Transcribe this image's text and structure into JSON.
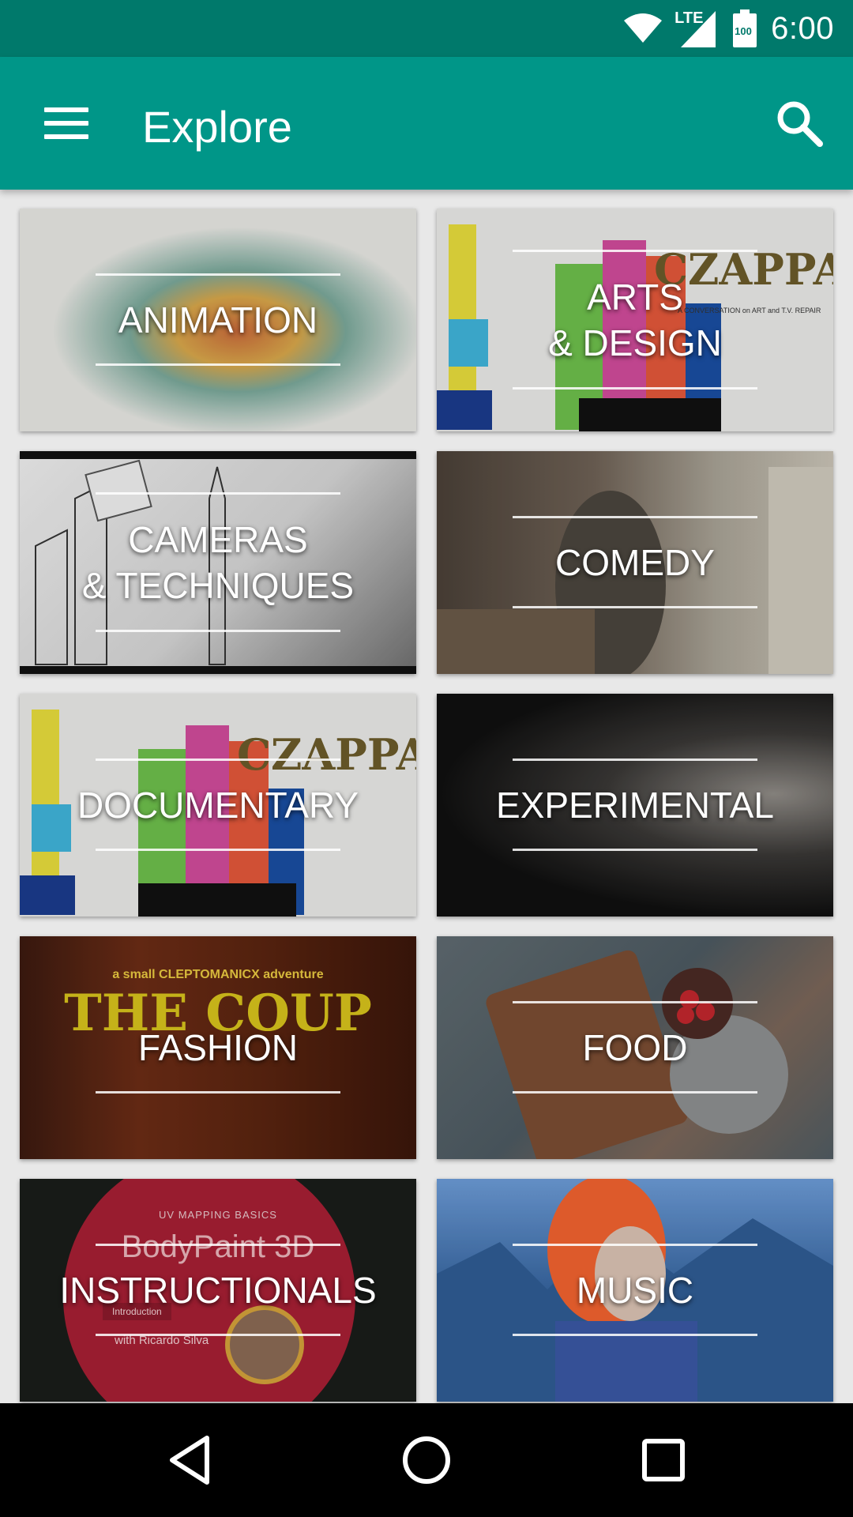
{
  "status_bar": {
    "network": "LTE",
    "battery": "100",
    "time": "6:00",
    "icons": [
      "wifi-icon",
      "signal-icon",
      "battery-icon"
    ]
  },
  "app_bar": {
    "title": "Explore",
    "menu_icon": "hamburger-menu-icon",
    "search_icon": "search-icon",
    "color": "#009688",
    "status_color": "#00796b"
  },
  "categories": [
    {
      "id": "animation",
      "label": "ANIMATION"
    },
    {
      "id": "arts-design",
      "label": "ARTS\n& DESIGN"
    },
    {
      "id": "cameras-techniques",
      "label": "CAMERAS\n& TECHNIQUES"
    },
    {
      "id": "comedy",
      "label": "COMEDY"
    },
    {
      "id": "documentary",
      "label": "DOCUMENTARY"
    },
    {
      "id": "experimental",
      "label": "EXPERIMENTAL"
    },
    {
      "id": "fashion",
      "label": "FASHION"
    },
    {
      "id": "food",
      "label": "FOOD"
    },
    {
      "id": "instructionals",
      "label": "INSTRUCTIONALS"
    },
    {
      "id": "music",
      "label": "MUSIC"
    }
  ],
  "thumbnail_text": {
    "czappa": "CZAPPA",
    "czappa_sub": "A CONVERSATION on ART and T.V. REPAIR",
    "coup_tagline": "a small CLEPTOMANICX adventure",
    "coup_title": "THE COUP",
    "uv_title": "UV MAPPING BASICS",
    "bodypaint": "BodyPaint 3D",
    "intro": "Introduction",
    "presenter": "with Ricardo Silva"
  },
  "nav_bar": {
    "back_icon": "back-triangle-icon",
    "home_icon": "home-circle-icon",
    "recents_icon": "recents-square-icon"
  }
}
